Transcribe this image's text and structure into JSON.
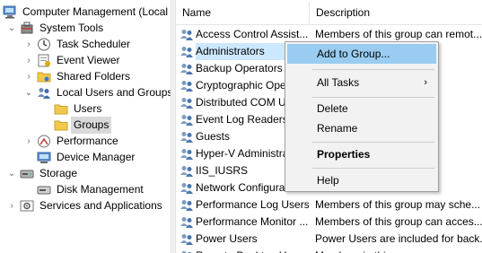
{
  "tree": {
    "items": [
      {
        "label": "Computer Management (Local",
        "expander": "",
        "icon": "computer-management-icon"
      },
      {
        "label": "System Tools",
        "expander": "⌄",
        "icon": "system-tools-icon"
      },
      {
        "label": "Task Scheduler",
        "expander": "›",
        "icon": "clock-icon"
      },
      {
        "label": "Event Viewer",
        "expander": "›",
        "icon": "event-viewer-icon"
      },
      {
        "label": "Shared Folders",
        "expander": "›",
        "icon": "shared-folder-icon"
      },
      {
        "label": "Local Users and Groups",
        "expander": "⌄",
        "icon": "users-groups-icon"
      },
      {
        "label": "Users",
        "expander": "",
        "icon": "folder-icon"
      },
      {
        "label": "Groups",
        "expander": "",
        "icon": "folder-icon"
      },
      {
        "label": "Performance",
        "expander": "›",
        "icon": "performance-icon"
      },
      {
        "label": "Device Manager",
        "expander": "",
        "icon": "device-manager-icon"
      },
      {
        "label": "Storage",
        "expander": "⌄",
        "icon": "storage-icon"
      },
      {
        "label": "Disk Management",
        "expander": "",
        "icon": "disk-icon"
      },
      {
        "label": "Services and Applications",
        "expander": "›",
        "icon": "services-icon"
      }
    ]
  },
  "list": {
    "columns": {
      "name": "Name",
      "description": "Description"
    },
    "rows": [
      {
        "name": "Access Control Assist...",
        "description": "Members of this group can remot..."
      },
      {
        "name": "Administrators",
        "description": "...delete an..."
      },
      {
        "name": "Backup Operators",
        "description": "...erride se..."
      },
      {
        "name": "Cryptographic Ope",
        "description": "...perfor..."
      },
      {
        "name": "Distributed COM U",
        "description": "...unch, a..."
      },
      {
        "name": "Event Log Readers",
        "description": "...read e..."
      },
      {
        "name": "Guests",
        "description": "...ess as..."
      },
      {
        "name": "Hyper-V Administra",
        "description": "...ete and..."
      },
      {
        "name": "IIS_IUSRS",
        "description": "...ernet Inf..."
      },
      {
        "name": "Network Configura",
        "description": "...have s..."
      },
      {
        "name": "Performance Log Users",
        "description": "Members of this group may sche..."
      },
      {
        "name": "Performance Monitor ...",
        "description": "Members of this group can acces..."
      },
      {
        "name": "Power Users",
        "description": "Power Users are included for back..."
      },
      {
        "name": "Remote Desktop Users",
        "description": "Members in this group are gran..."
      }
    ]
  },
  "context_menu": {
    "items": [
      {
        "label": "Add to Group..."
      },
      {
        "label": "All Tasks",
        "submenu_arrow": "›"
      },
      {
        "label": "Delete"
      },
      {
        "label": "Rename"
      },
      {
        "label": "Properties"
      },
      {
        "label": "Help"
      }
    ]
  },
  "colors": {
    "selection": "#cce8ff",
    "menu_hover": "#99ccf0",
    "menu_bg": "#f2f2f2"
  }
}
